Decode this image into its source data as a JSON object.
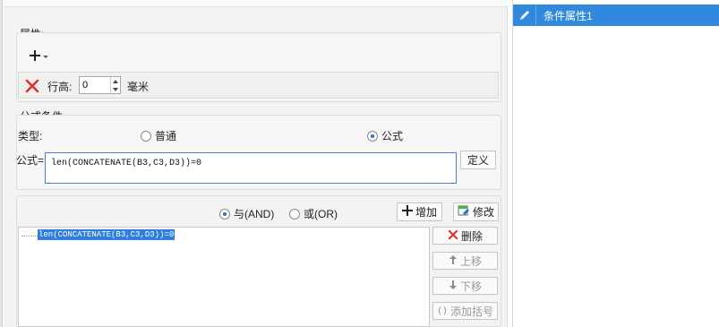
{
  "attributes": {
    "section_label": "属性:",
    "row_height_label": "行高:",
    "row_height_value": "0",
    "unit_label": "毫米"
  },
  "formula_condition": {
    "section_label": "公式条件",
    "type_label": "类型:",
    "type_options": [
      "普通",
      "公式"
    ],
    "selected_type": "公式",
    "formula_label": "公式=",
    "formula_value": "len(CONCATENATE(B3,C3,D3))=0",
    "define_button": "定义"
  },
  "logic": {
    "and_label": "与(AND)",
    "or_label": "或(OR)",
    "selected": "与(AND)",
    "add_button": "增加",
    "modify_button": "修改"
  },
  "condition_list": {
    "items": [
      "len(CONCATENATE(B3,C3,D3))=0"
    ],
    "delete_button": "删除",
    "move_up_button": "上移",
    "move_down_button": "下移",
    "add_bracket_button": "添加括号"
  },
  "right_panel": {
    "items": [
      "条件属性1"
    ]
  },
  "colors": {
    "accent": "#3189de",
    "selection": "#2e7ee0",
    "delete_red": "#e0302c",
    "formula_border": "#4a7fd0"
  }
}
